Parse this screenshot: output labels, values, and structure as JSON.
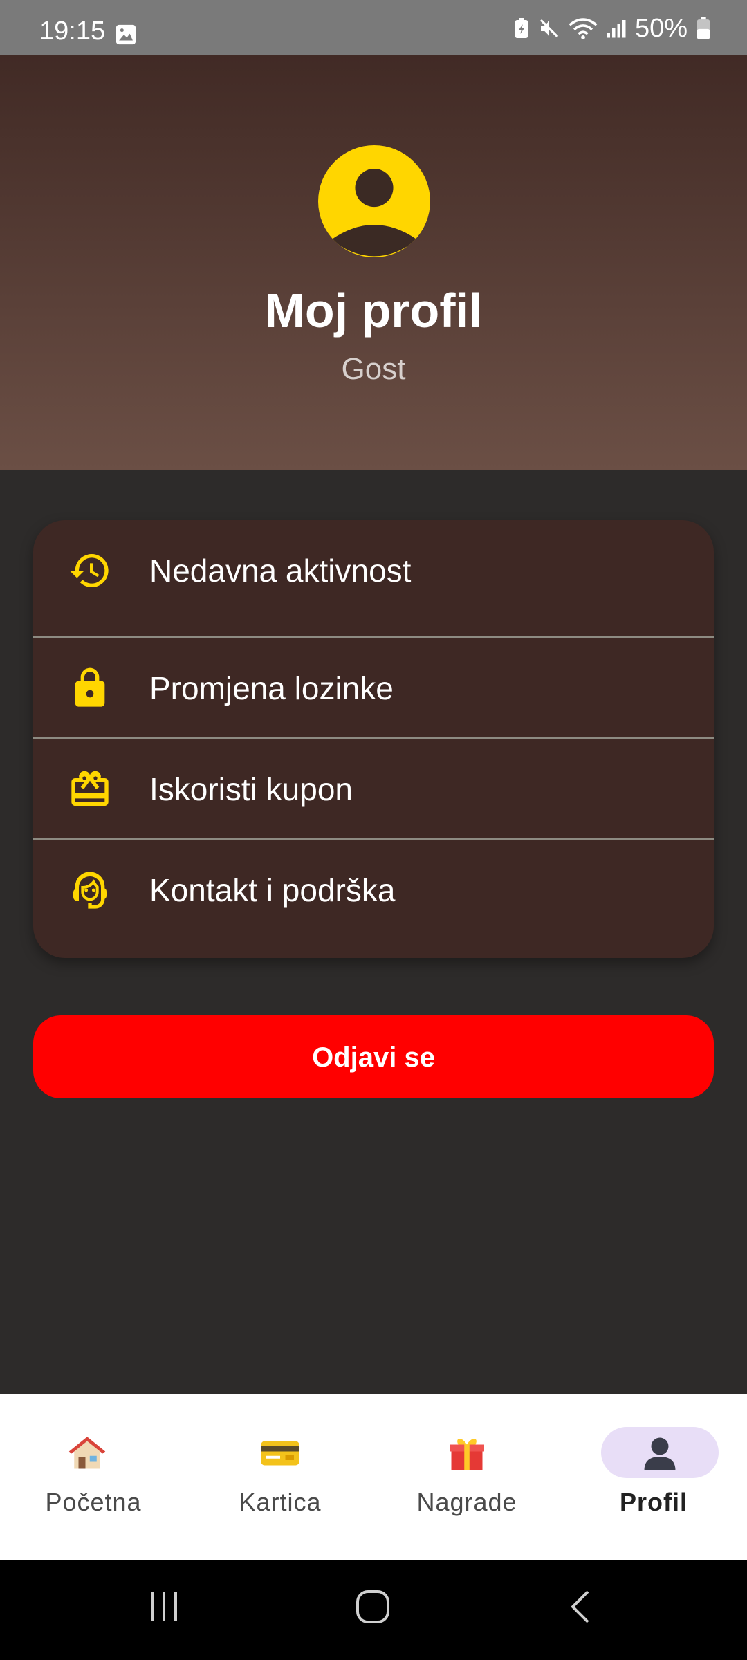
{
  "status_bar": {
    "time": "19:15",
    "battery_text": "50%"
  },
  "header": {
    "title": "Moj profil",
    "subtitle": "Gost",
    "avatar_icon": "account-circle-icon"
  },
  "menu": {
    "items": [
      {
        "label": "Nedavna aktivnost",
        "icon": "history-icon"
      },
      {
        "label": "Promjena lozinke",
        "icon": "lock-icon"
      },
      {
        "label": "Iskoristi kupon",
        "icon": "redeem-icon"
      },
      {
        "label": "Kontakt i podrška",
        "icon": "support-agent-icon"
      }
    ]
  },
  "logout_label": "Odjavi se",
  "bottom_nav": {
    "items": [
      {
        "label": "Početna",
        "icon": "house-icon",
        "active": false
      },
      {
        "label": "Kartica",
        "icon": "credit-card-icon",
        "active": false
      },
      {
        "label": "Nagrade",
        "icon": "gift-icon",
        "active": false
      },
      {
        "label": "Profil",
        "icon": "person-silhouette-icon",
        "active": true
      }
    ]
  },
  "colors": {
    "accent_yellow": "#ffd600",
    "logout_red": "#ff0000",
    "card_bg": "#3e2824",
    "page_bg": "#2d2b2a",
    "active_pill": "#e8def7"
  }
}
